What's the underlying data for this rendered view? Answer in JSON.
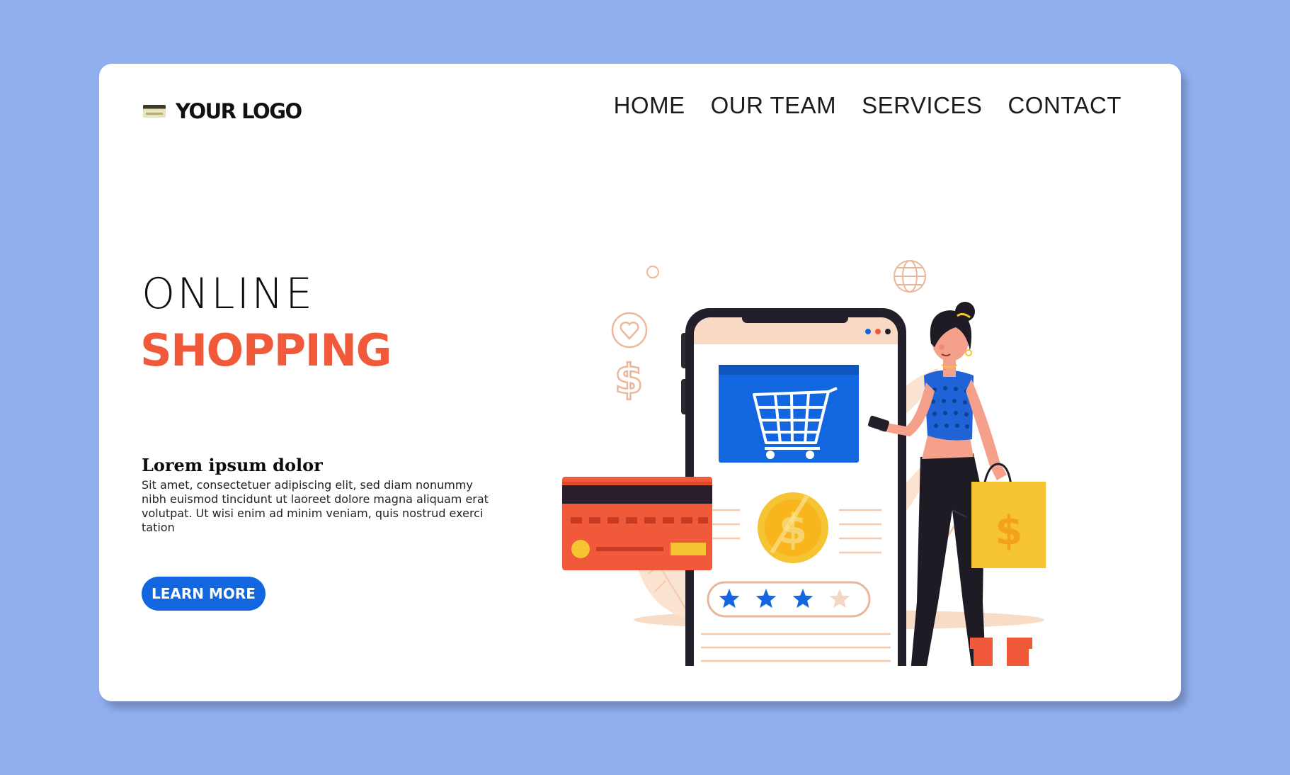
{
  "logo": {
    "icon": "card-icon",
    "text": "YOUR LOGO"
  },
  "nav": {
    "items": [
      {
        "label": "HOME"
      },
      {
        "label": "OUR TEAM"
      },
      {
        "label": "SERVICES"
      },
      {
        "label": "CONTACT"
      }
    ]
  },
  "hero": {
    "title_top": "ONLINE",
    "title_bottom": "SHOPPING",
    "subtitle": "Lorem ipsum dolor",
    "body": "Sit amet, consectetuer adipiscing elit, sed diam nonummy nibh euismod tincidunt ut laoreet dolore magna aliquam erat volutpat. Ut wisi enim ad minim veniam, quis nostrud exerci tation",
    "cta_label": "LEARN MORE"
  },
  "illustration": {
    "rating_stars_filled": 3,
    "rating_stars_total": 4
  },
  "colors": {
    "background": "#91AFEF",
    "card": "#FFFFFF",
    "accent_red": "#F05A3B",
    "accent_blue": "#1267E0",
    "coin_yellow": "#F6C332"
  }
}
